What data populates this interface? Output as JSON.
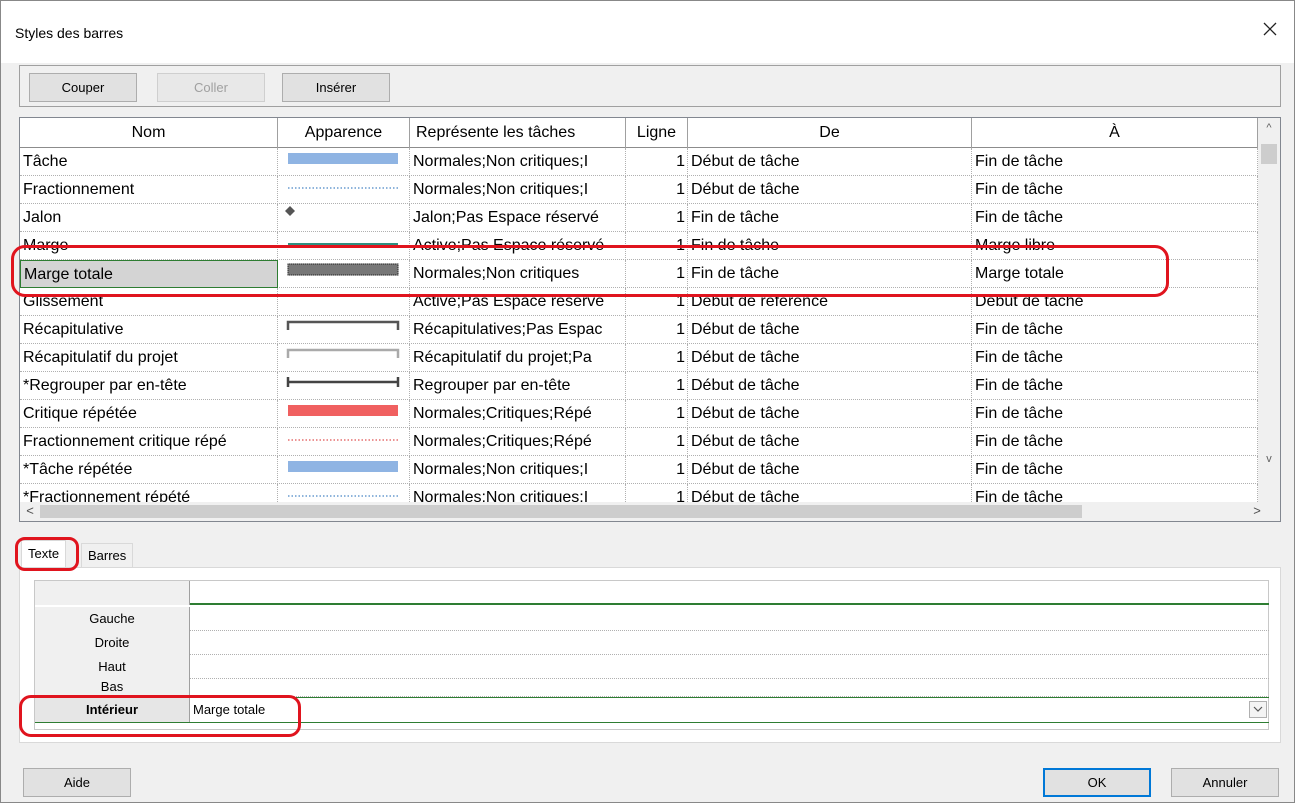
{
  "window": {
    "title": "Styles des barres"
  },
  "toolbar": {
    "cut_label": "Couper",
    "paste_label": "Coller",
    "insert_label": "Insérer"
  },
  "grid": {
    "headers": [
      "Nom",
      "Apparence",
      "Représente les tâches",
      "Ligne",
      "De",
      "À"
    ],
    "rows": [
      {
        "name": "Tâche",
        "represents": "Normales;Non critiques;I",
        "line": "1",
        "from": "Début de tâche",
        "to": "Fin de tâche",
        "appearance": "bar-blue"
      },
      {
        "name": "Fractionnement",
        "represents": "Normales;Non critiques;I",
        "line": "1",
        "from": "Début de tâche",
        "to": "Fin de tâche",
        "appearance": "dotted-blue"
      },
      {
        "name": "Jalon",
        "represents": "Jalon;Pas Espace réservé",
        "line": "1",
        "from": "Fin de tâche",
        "to": "Fin de tâche",
        "appearance": "diamond"
      },
      {
        "name": "Marge",
        "represents": "Active;Pas Espace réservé",
        "line": "1",
        "from": "Fin de tâche",
        "to": "Marge libre",
        "appearance": "thin-teal"
      },
      {
        "name": "Marge totale",
        "represents": "Normales;Non critiques",
        "line": "1",
        "from": "Fin de tâche",
        "to": "Marge totale",
        "appearance": "hatched-gray",
        "selected": true
      },
      {
        "name": "Glissement",
        "represents": "Active;Pas Espace réservé",
        "line": "1",
        "from": "Début de référence",
        "to": "Début de tâche",
        "appearance": "none"
      },
      {
        "name": "Récapitulative",
        "represents": "Récapitulatives;Pas Espac",
        "line": "1",
        "from": "Début de tâche",
        "to": "Fin de tâche",
        "appearance": "bracket-dark"
      },
      {
        "name": "Récapitulatif du projet",
        "represents": "Récapitulatif du projet;Pa",
        "line": "1",
        "from": "Début de tâche",
        "to": "Fin de tâche",
        "appearance": "bracket-light"
      },
      {
        "name": "*Regrouper par en-tête",
        "represents": "Regrouper par en-tête",
        "line": "1",
        "from": "Début de tâche",
        "to": "Fin de tâche",
        "appearance": "bracket-bar"
      },
      {
        "name": "Critique répétée",
        "represents": "Normales;Critiques;Répé",
        "line": "1",
        "from": "Début de tâche",
        "to": "Fin de tâche",
        "appearance": "bar-red"
      },
      {
        "name": "Fractionnement critique répé",
        "represents": "Normales;Critiques;Répé",
        "line": "1",
        "from": "Début de tâche",
        "to": "Fin de tâche",
        "appearance": "dotted-red"
      },
      {
        "name": "*Tâche répétée",
        "represents": "Normales;Non critiques;I",
        "line": "1",
        "from": "Début de tâche",
        "to": "Fin de tâche",
        "appearance": "bar-blue"
      },
      {
        "name": "*Fractionnement répété",
        "represents": "Normales;Non critiques;I",
        "line": "1",
        "from": "Début de tâche",
        "to": "Fin de tâche",
        "appearance": "dotted-blue"
      }
    ]
  },
  "tabs": [
    {
      "label": "Texte",
      "active": true
    },
    {
      "label": "Barres",
      "active": false
    }
  ],
  "text_panel": {
    "rows": [
      {
        "label": "Gauche",
        "value": ""
      },
      {
        "label": "Droite",
        "value": ""
      },
      {
        "label": "Haut",
        "value": ""
      },
      {
        "label": "Bas",
        "value": ""
      },
      {
        "label": "Intérieur",
        "value": "Marge totale",
        "selected": true
      }
    ]
  },
  "buttons": {
    "help_label": "Aide",
    "ok_label": "OK",
    "cancel_label": "Annuler"
  },
  "colors": {
    "annotation": "#e0141e",
    "bar_blue": "#8fb4e3",
    "bar_red": "#f06060",
    "teal": "#2f8f80",
    "selection_border": "#2e7d32"
  }
}
